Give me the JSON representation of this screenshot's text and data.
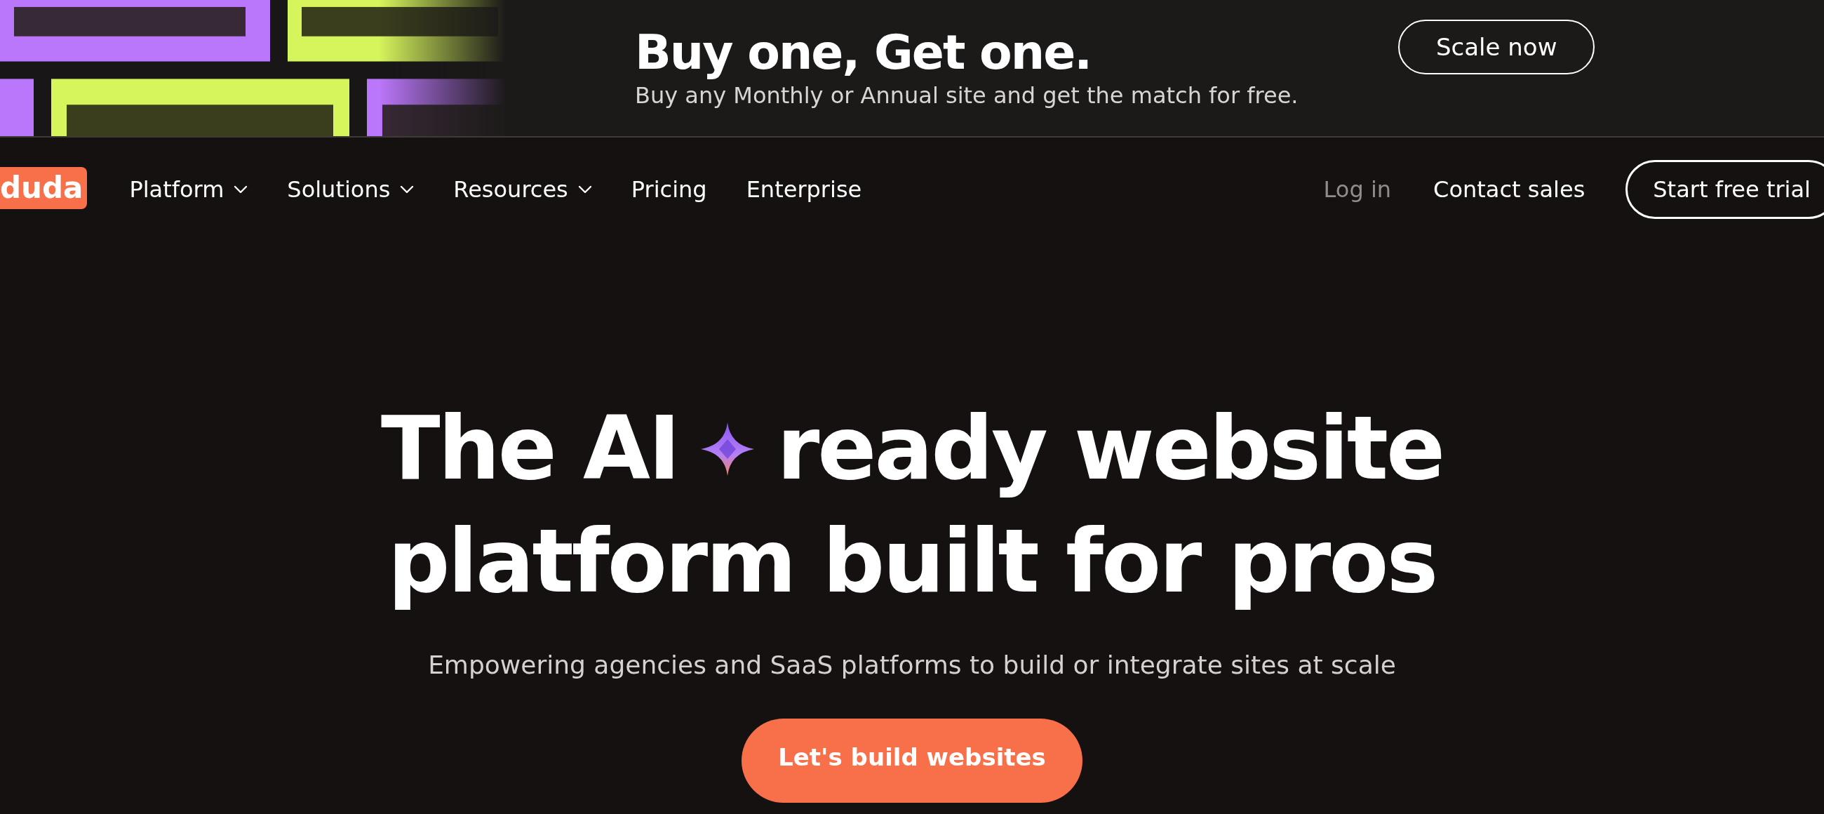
{
  "promo_banner": {
    "title": "Buy one, Get one.",
    "subtitle": "Buy any Monthly or Annual site and get the match for free.",
    "button": "Scale now"
  },
  "nav": {
    "logo": "duda",
    "items": [
      {
        "label": "Platform",
        "has_dropdown": true
      },
      {
        "label": "Solutions",
        "has_dropdown": true
      },
      {
        "label": "Resources",
        "has_dropdown": true
      },
      {
        "label": "Pricing",
        "has_dropdown": false
      },
      {
        "label": "Enterprise",
        "has_dropdown": false
      }
    ],
    "login": "Log in",
    "contact": "Contact sales",
    "cta": "Start free trial"
  },
  "hero": {
    "headline_before_icon": "The AI",
    "headline_after_icon": "ready website",
    "headline_line_2": "platform built for pros",
    "subtitle": "Empowering agencies and SaaS platforms to build or integrate sites at scale",
    "button": "Let's build websites"
  }
}
